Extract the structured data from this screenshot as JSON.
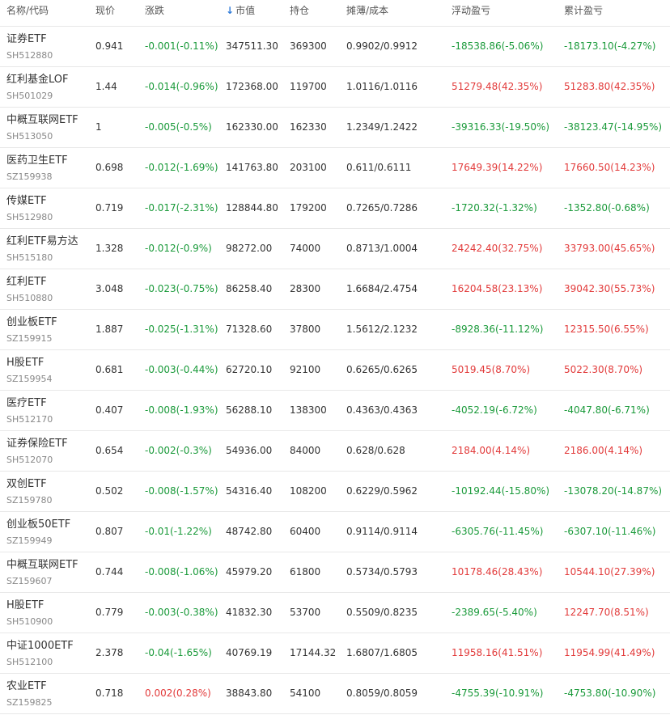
{
  "header": {
    "name": "名称/代码",
    "price": "现价",
    "change": "涨跌",
    "value": "市值",
    "position": "持仓",
    "cost": "摊薄/成本",
    "float_pl": "浮动盈亏",
    "total_pl": "累计盈亏",
    "sort_icon": "↓"
  },
  "colors": {
    "up": "#e23a3a",
    "down": "#1a9a3a",
    "sort": "#2f7bd8"
  },
  "rows": [
    {
      "name": "证券ETF",
      "code": "SH512880",
      "price": "0.941",
      "change": "-0.001(-0.11%)",
      "value": "347511.30",
      "position": "369300",
      "cost": "0.9902/0.9912",
      "float_pl": "-18538.86(-5.06%)",
      "total_pl": "-18173.10(-4.27%)"
    },
    {
      "name": "红利基金LOF",
      "code": "SH501029",
      "price": "1.44",
      "change": "-0.014(-0.96%)",
      "value": "172368.00",
      "position": "119700",
      "cost": "1.0116/1.0116",
      "float_pl": "51279.48(42.35%)",
      "total_pl": "51283.80(42.35%)"
    },
    {
      "name": "中概互联网ETF",
      "code": "SH513050",
      "price": "1",
      "change": "-0.005(-0.5%)",
      "value": "162330.00",
      "position": "162330",
      "cost": "1.2349/1.2422",
      "float_pl": "-39316.33(-19.50%)",
      "total_pl": "-38123.47(-14.95%)"
    },
    {
      "name": "医药卫生ETF",
      "code": "SZ159938",
      "price": "0.698",
      "change": "-0.012(-1.69%)",
      "value": "141763.80",
      "position": "203100",
      "cost": "0.611/0.6111",
      "float_pl": "17649.39(14.22%)",
      "total_pl": "17660.50(14.23%)"
    },
    {
      "name": "传媒ETF",
      "code": "SH512980",
      "price": "0.719",
      "change": "-0.017(-2.31%)",
      "value": "128844.80",
      "position": "179200",
      "cost": "0.7265/0.7286",
      "float_pl": "-1720.32(-1.32%)",
      "total_pl": "-1352.80(-0.68%)"
    },
    {
      "name": "红利ETF易方达",
      "code": "SH515180",
      "price": "1.328",
      "change": "-0.012(-0.9%)",
      "value": "98272.00",
      "position": "74000",
      "cost": "0.8713/1.0004",
      "float_pl": "24242.40(32.75%)",
      "total_pl": "33793.00(45.65%)"
    },
    {
      "name": "红利ETF",
      "code": "SH510880",
      "price": "3.048",
      "change": "-0.023(-0.75%)",
      "value": "86258.40",
      "position": "28300",
      "cost": "1.6684/2.4754",
      "float_pl": "16204.58(23.13%)",
      "total_pl": "39042.30(55.73%)"
    },
    {
      "name": "创业板ETF",
      "code": "SZ159915",
      "price": "1.887",
      "change": "-0.025(-1.31%)",
      "value": "71328.60",
      "position": "37800",
      "cost": "1.5612/2.1232",
      "float_pl": "-8928.36(-11.12%)",
      "total_pl": "12315.50(6.55%)"
    },
    {
      "name": "H股ETF",
      "code": "SZ159954",
      "price": "0.681",
      "change": "-0.003(-0.44%)",
      "value": "62720.10",
      "position": "92100",
      "cost": "0.6265/0.6265",
      "float_pl": "5019.45(8.70%)",
      "total_pl": "5022.30(8.70%)"
    },
    {
      "name": "医疗ETF",
      "code": "SH512170",
      "price": "0.407",
      "change": "-0.008(-1.93%)",
      "value": "56288.10",
      "position": "138300",
      "cost": "0.4363/0.4363",
      "float_pl": "-4052.19(-6.72%)",
      "total_pl": "-4047.80(-6.71%)"
    },
    {
      "name": "证券保险ETF",
      "code": "SH512070",
      "price": "0.654",
      "change": "-0.002(-0.3%)",
      "value": "54936.00",
      "position": "84000",
      "cost": "0.628/0.628",
      "float_pl": "2184.00(4.14%)",
      "total_pl": "2186.00(4.14%)"
    },
    {
      "name": "双创ETF",
      "code": "SZ159780",
      "price": "0.502",
      "change": "-0.008(-1.57%)",
      "value": "54316.40",
      "position": "108200",
      "cost": "0.6229/0.5962",
      "float_pl": "-10192.44(-15.80%)",
      "total_pl": "-13078.20(-14.87%)"
    },
    {
      "name": "创业板50ETF",
      "code": "SZ159949",
      "price": "0.807",
      "change": "-0.01(-1.22%)",
      "value": "48742.80",
      "position": "60400",
      "cost": "0.9114/0.9114",
      "float_pl": "-6305.76(-11.45%)",
      "total_pl": "-6307.10(-11.46%)"
    },
    {
      "name": "中概互联网ETF",
      "code": "SZ159607",
      "price": "0.744",
      "change": "-0.008(-1.06%)",
      "value": "45979.20",
      "position": "61800",
      "cost": "0.5734/0.5793",
      "float_pl": "10178.46(28.43%)",
      "total_pl": "10544.10(27.39%)"
    },
    {
      "name": "H股ETF",
      "code": "SH510900",
      "price": "0.779",
      "change": "-0.003(-0.38%)",
      "value": "41832.30",
      "position": "53700",
      "cost": "0.5509/0.8235",
      "float_pl": "-2389.65(-5.40%)",
      "total_pl": "12247.70(8.51%)"
    },
    {
      "name": "中证1000ETF",
      "code": "SH512100",
      "price": "2.378",
      "change": "-0.04(-1.65%)",
      "value": "40769.19",
      "position": "17144.32",
      "cost": "1.6807/1.6805",
      "float_pl": "11958.16(41.51%)",
      "total_pl": "11954.99(41.49%)"
    },
    {
      "name": "农业ETF",
      "code": "SZ159825",
      "price": "0.718",
      "change": "0.002(0.28%)",
      "value": "38843.80",
      "position": "54100",
      "cost": "0.8059/0.8059",
      "float_pl": "-4755.39(-10.91%)",
      "total_pl": "-4753.80(-10.90%)"
    }
  ]
}
